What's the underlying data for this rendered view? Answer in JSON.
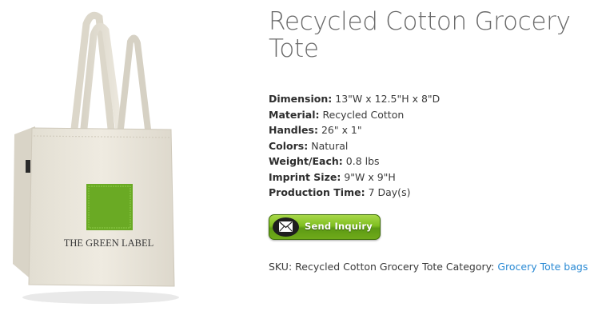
{
  "product": {
    "title": "Recycled Cotton Grocery Tote",
    "image": {
      "bag_print": "THE GREEN LABEL",
      "icon": "tote-bag-image"
    }
  },
  "specs": [
    {
      "label": "Dimension:",
      "value": "13\"W x 12.5\"H x 8\"D"
    },
    {
      "label": "Material:",
      "value": "Recycled Cotton"
    },
    {
      "label": "Handles:",
      "value": "26\" x 1\""
    },
    {
      "label": "Colors:",
      "value": "Natural"
    },
    {
      "label": "Weight/Each:",
      "value": "0.8 lbs"
    },
    {
      "label": "Imprint Size:",
      "value": "9\"W x 9\"H"
    },
    {
      "label": "Production Time:",
      "value": "7 Day(s)"
    }
  ],
  "inquiry_button": {
    "label": "Send Inquiry",
    "icon": "envelope-icon"
  },
  "meta": {
    "sku_label": "SKU:",
    "sku_value": "Recycled Cotton Grocery Tote",
    "category_label": "Category:",
    "category_link": "Grocery Tote bags"
  },
  "colors": {
    "accent_green": "#7fbf1f",
    "link": "#2a8ad4",
    "bag": "#ece8dd",
    "print_green": "#6aaa24"
  }
}
